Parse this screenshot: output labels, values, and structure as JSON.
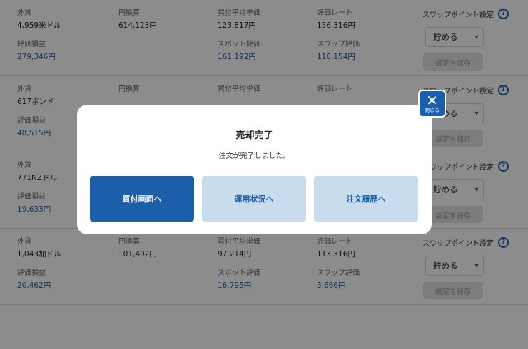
{
  "labels": {
    "currency": "外貨",
    "yen": "円換算",
    "avg_price": "買付平均単価",
    "rate": "評価レート",
    "pnl": "評価損益",
    "spot": "スポット評価",
    "swap_eval": "スワップ評価",
    "swap_setting": "スワップポイント設定",
    "help": "?",
    "save": "設定を保存"
  },
  "rows": [
    {
      "currency": "4,959米ドル",
      "yen": "614,123円",
      "avg": "123.817円",
      "rate": "156.316円",
      "pnl": "279,346円",
      "spot": "161,192円",
      "swap": "118,154円",
      "select": "貯める"
    },
    {
      "currency": "617ポンド",
      "yen": "",
      "avg": "",
      "rate": "",
      "pnl": "48,515円",
      "spot": "",
      "swap": "",
      "select": "貯める"
    },
    {
      "currency": "771NZドル",
      "yen": "",
      "avg": "",
      "rate": "",
      "pnl": "19,633円",
      "spot": "",
      "swap": "",
      "select": "貯める"
    },
    {
      "currency": "1,043加ドル",
      "yen": "101,402円",
      "avg": "97.214円",
      "rate": "113.316円",
      "pnl": "20,462円",
      "spot": "16,795円",
      "swap": "3,666円",
      "select": "貯める"
    }
  ],
  "modal": {
    "title": "売却完了",
    "message": "注文が完了しました。",
    "btn_buy": "買付画面へ",
    "btn_status": "運用状況へ",
    "btn_history": "注文履歴へ",
    "close_label": "閉じる",
    "close_glyph": "✕"
  },
  "colors": {
    "accent": "#1b5eab",
    "secondary_button": "#c8dced",
    "overlay": "rgba(0,0,0,0.45)"
  }
}
